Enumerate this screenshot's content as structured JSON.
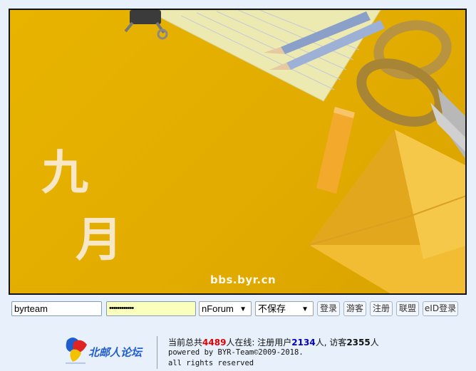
{
  "banner": {
    "month_char_1": "九",
    "month_char_2": "月",
    "watermark": "bbs.byr.cn"
  },
  "login": {
    "username_value": "byrteam",
    "password_mask": "••••••••••••",
    "forum_select": "nForum",
    "save_select": "不保存",
    "buttons": {
      "login": "登录",
      "guest": "游客",
      "register": "注册",
      "union": "联盟",
      "eid_login": "eID登录"
    }
  },
  "footer": {
    "logo_text": "北邮人论坛",
    "stats_prefix": "当前总共",
    "total_online": "4489",
    "stats_mid1": "人在线: 注册用户",
    "registered_users": "2134",
    "stats_mid2": "人, 访客",
    "guests": "2355",
    "stats_suffix": "人",
    "powered": "powered by BYR-Team©2009-2018.",
    "rights": "all rights reserved"
  }
}
